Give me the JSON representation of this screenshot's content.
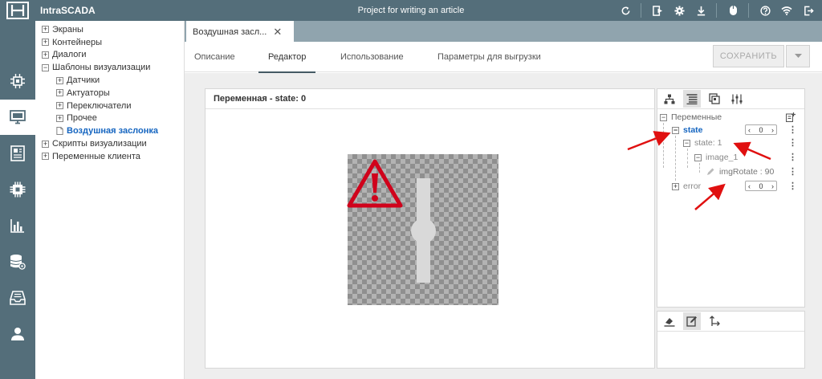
{
  "app": {
    "title": "IntraSCADA",
    "project": "Project for writing an article"
  },
  "tree": {
    "items": [
      {
        "label": "Экраны",
        "toggle": "+",
        "level": 0
      },
      {
        "label": "Контейнеры",
        "toggle": "+",
        "level": 0
      },
      {
        "label": "Диалоги",
        "toggle": "+",
        "level": 0
      },
      {
        "label": "Шаблоны визуализации",
        "toggle": "−",
        "level": 0
      },
      {
        "label": "Датчики",
        "toggle": "+",
        "level": 1
      },
      {
        "label": "Актуаторы",
        "toggle": "+",
        "level": 1
      },
      {
        "label": "Переключатели",
        "toggle": "+",
        "level": 1
      },
      {
        "label": "Прочее",
        "toggle": "+",
        "level": 1
      },
      {
        "label": "Воздушная заслонка",
        "toggle": "file",
        "level": 1,
        "selected": true
      },
      {
        "label": "Скрипты визуализации",
        "toggle": "+",
        "level": 0
      },
      {
        "label": "Переменные клиента",
        "toggle": "+",
        "level": 0
      }
    ]
  },
  "tab": {
    "label": "Воздушная засл...",
    "close": "✕"
  },
  "subtabs": [
    {
      "label": "Описание"
    },
    {
      "label": "Редактор",
      "active": true
    },
    {
      "label": "Использование"
    },
    {
      "label": "Параметры для выгрузки"
    }
  ],
  "save": {
    "label": "СОХРАНИТЬ"
  },
  "canvas": {
    "header": "Переменная - state: 0"
  },
  "variables": {
    "root_label": "Переменные",
    "state": {
      "label": "state",
      "value": "0"
    },
    "state_1": {
      "label": "state: 1"
    },
    "image_1": {
      "label": "image_1"
    },
    "img_rotate": {
      "label": "imgRotate : 90"
    },
    "error": {
      "label": "error",
      "value": "0"
    },
    "toggle_minus": "−",
    "toggle_plus": "+",
    "counter_left": "‹",
    "counter_right": "›",
    "menu": "⋮"
  },
  "colors": {
    "topbar": "#546e7a",
    "tabstrip": "#90a4ae",
    "accent": "#1565c0",
    "warning": "#d0021b",
    "arrow": "#e01010"
  }
}
